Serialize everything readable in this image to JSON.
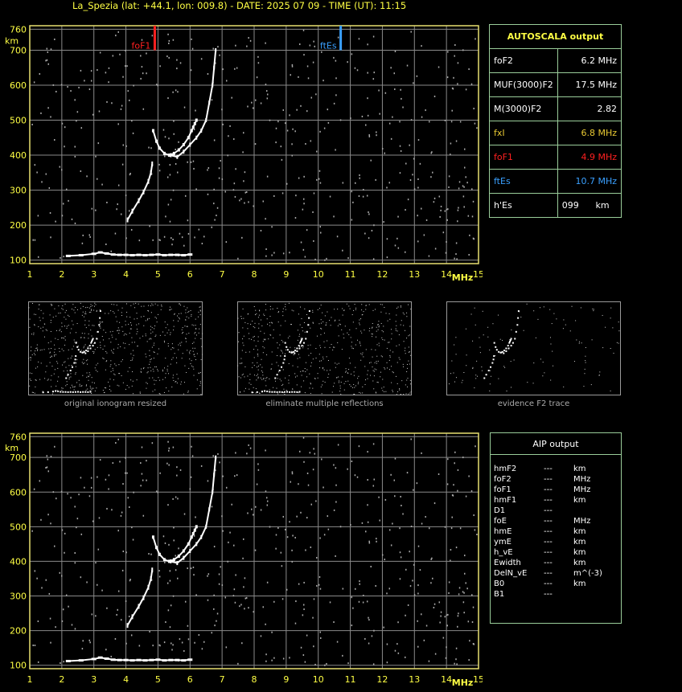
{
  "header": "La_Spezia (lat: +44.1, lon: 009.8) - DATE: 2025 07 09 - TIME (UT): 11:15",
  "axis": {
    "y_unit": "km",
    "y_ticks": [
      "760",
      "700",
      "600",
      "500",
      "400",
      "300",
      "200",
      "100"
    ],
    "x_unit": "MHz",
    "x_ticks": [
      "1",
      "2",
      "3",
      "4",
      "5",
      "6",
      "7",
      "8",
      "9",
      "10",
      "11",
      "12",
      "13",
      "14",
      "15"
    ]
  },
  "markers": {
    "foF1_label": "foF1",
    "ftEs_label": "ftEs"
  },
  "autoscala": {
    "title": "AUTOSCALA output",
    "rows": [
      {
        "name": "foF2",
        "value": "6.2 MHz",
        "color": "#ffffff"
      },
      {
        "name": "MUF(3000)F2",
        "value": "17.5 MHz",
        "color": "#ffffff"
      },
      {
        "name": "M(3000)F2",
        "value": "2.82",
        "color": "#ffffff"
      },
      {
        "name": "fxI",
        "value": "6.8 MHz",
        "color": "#e8c832"
      },
      {
        "name": "foF1",
        "value": "4.9 MHz",
        "color": "#ff2020"
      },
      {
        "name": "ftEs",
        "value": "10.7 MHz",
        "color": "#3aa0ff"
      },
      {
        "name": "h'Es",
        "value": "099",
        "unit": "km",
        "color": "#ffffff"
      }
    ]
  },
  "mini_captions": [
    "original ionogram resized",
    "eliminate multiple reflections",
    "evidence F2 trace"
  ],
  "aip": {
    "title": "AIP output",
    "rows": [
      {
        "name": "hmF2",
        "value": "---",
        "unit": "km"
      },
      {
        "name": "foF2",
        "value": "---",
        "unit": "MHz"
      },
      {
        "name": "foF1",
        "value": "---",
        "unit": "MHz"
      },
      {
        "name": "hmF1",
        "value": "---",
        "unit": "km"
      },
      {
        "name": "D1",
        "value": "---",
        "unit": ""
      },
      {
        "name": "foE",
        "value": "---",
        "unit": "MHz"
      },
      {
        "name": "hmE",
        "value": "---",
        "unit": "km"
      },
      {
        "name": "ymE",
        "value": "---",
        "unit": "km"
      },
      {
        "name": "h_vE",
        "value": "---",
        "unit": "km"
      },
      {
        "name": "Ewidth",
        "value": "---",
        "unit": "km"
      },
      {
        "name": "DelN_vE",
        "value": "---",
        "unit": "m^(-3)"
      },
      {
        "name": "B0",
        "value": "---",
        "unit": "km"
      },
      {
        "name": "B1",
        "value": "---",
        "unit": ""
      }
    ]
  },
  "chart_data": {
    "type": "scatter",
    "title": "",
    "xlabel": "MHz",
    "ylabel": "km",
    "xlim": [
      1,
      15
    ],
    "ylim": [
      90,
      770
    ],
    "grid": true,
    "colors": {
      "grid": "#8a8a8a",
      "frame": "#e8e070",
      "trace": "#ffffff",
      "noise": "#aaaaaa",
      "foF1": "#ff2020",
      "ftEs": "#3aa0ff"
    },
    "foF1_mhz": 4.9,
    "ftEs_mhz": 10.7,
    "es_layer": {
      "name": "Es",
      "x": [
        2.2,
        2.6,
        3.0,
        3.2,
        3.4,
        3.6,
        3.8,
        4.0,
        4.2,
        4.4,
        4.6,
        4.8,
        5.0,
        5.2,
        5.4,
        5.6,
        5.8,
        6.0
      ],
      "y": [
        112,
        114,
        118,
        122,
        119,
        116,
        115,
        115,
        114,
        115,
        114,
        115,
        116,
        114,
        115,
        115,
        114,
        116
      ]
    },
    "f1_trace": {
      "name": "F1",
      "x": [
        4.05,
        4.2,
        4.4,
        4.55,
        4.7,
        4.78,
        4.82
      ],
      "y": [
        215,
        240,
        270,
        295,
        325,
        350,
        375
      ]
    },
    "f2_o_trace": {
      "name": "F2 o",
      "x": [
        4.85,
        4.95,
        5.05,
        5.2,
        5.35,
        5.5,
        5.65,
        5.8,
        5.95,
        6.05,
        6.1,
        6.15,
        6.2
      ],
      "y": [
        470,
        440,
        420,
        405,
        400,
        405,
        415,
        430,
        450,
        470,
        480,
        490,
        500
      ]
    },
    "f2_x_trace": {
      "name": "F2 x",
      "x": [
        5.4,
        5.6,
        5.8,
        6.0,
        6.2,
        6.35,
        6.5,
        6.6,
        6.7,
        6.75,
        6.8
      ],
      "y": [
        400,
        395,
        410,
        430,
        450,
        470,
        500,
        550,
        600,
        650,
        700
      ]
    }
  }
}
